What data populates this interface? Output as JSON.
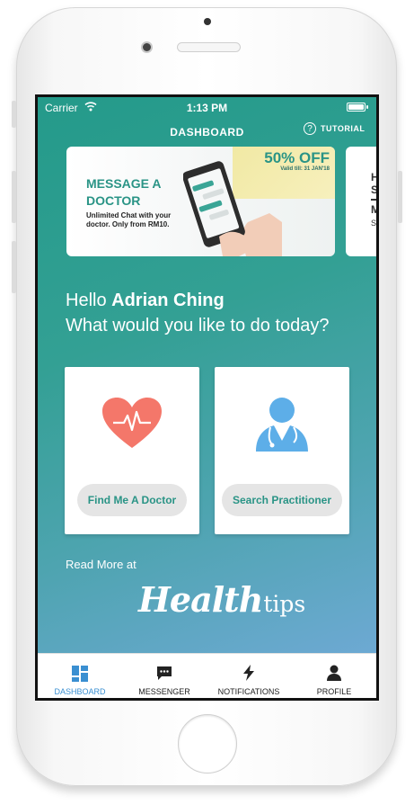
{
  "status_bar": {
    "carrier": "Carrier",
    "time": "1:13 PM"
  },
  "header": {
    "title": "DASHBOARD",
    "tutorial_label": "TUTORIAL",
    "help_glyph": "?"
  },
  "banners": [
    {
      "title": "MESSAGE A DOCTOR",
      "subtitle": "Unlimited Chat with your doctor. Only from RM10.",
      "offer": "50% OFF",
      "valid": "Valid till: 31 JAN'18"
    },
    {
      "partial_lines": [
        "H",
        "S",
        "M",
        "S"
      ]
    }
  ],
  "greeting": {
    "prefix": "Hello",
    "name": "Adrian Ching",
    "question": "What would you like to do today?"
  },
  "cards": [
    {
      "icon": "heart-pulse-icon",
      "button_label": "Find Me A Doctor"
    },
    {
      "icon": "doctor-icon",
      "button_label": "Search Practitioner"
    }
  ],
  "read_more": {
    "label": "Read More at",
    "logo_main": "Health",
    "logo_sub": "tips"
  },
  "tabs": [
    {
      "label": "DASHBOARD",
      "icon": "dashboard-icon",
      "active": true
    },
    {
      "label": "MESSENGER",
      "icon": "chat-icon",
      "active": false
    },
    {
      "label": "NOTIFICATIONS",
      "icon": "lightning-icon",
      "active": false
    },
    {
      "label": "PROFILE",
      "icon": "person-icon",
      "active": false
    }
  ],
  "colors": {
    "primary": "#2a9486",
    "gradient_end": "#6da9d3",
    "active_tab": "#3a8fd1",
    "heart": "#f4776a",
    "doctor": "#5daee8"
  }
}
